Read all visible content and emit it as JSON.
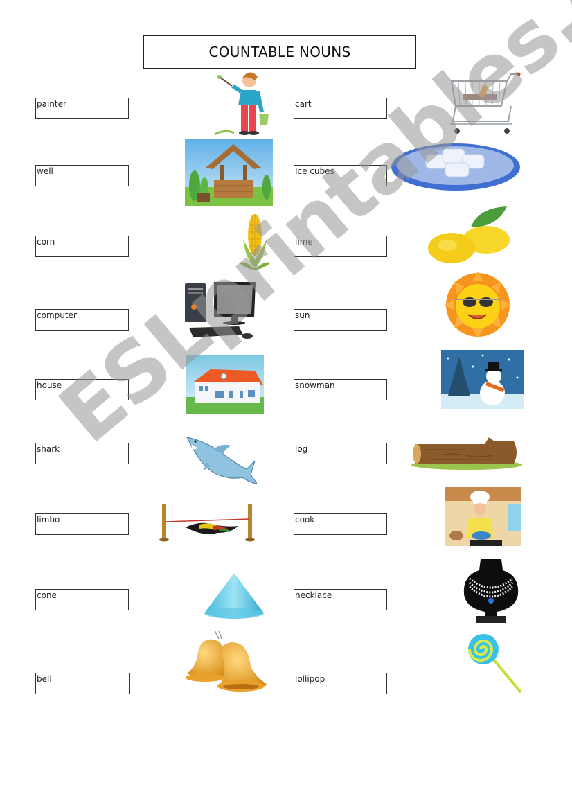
{
  "title": "COUNTABLE NOUNS",
  "watermark": "ESLprintables.com",
  "left_words": [
    "painter",
    "well",
    "corn",
    "computer",
    "house",
    "shark",
    "limbo",
    "cone",
    "bell"
  ],
  "right_words": [
    "cart",
    "Ice cubes",
    "lime",
    "sun",
    "snowman",
    "log",
    "cook",
    "necklace",
    "lollipop"
  ],
  "pictures": {
    "middle": [
      "painter",
      "well",
      "corn",
      "computer",
      "house",
      "shark",
      "limbo",
      "cone",
      "bells"
    ],
    "right": [
      "shopping-cart",
      "ice-cubes-plate",
      "lemons",
      "sun-sunglasses",
      "snowman",
      "log",
      "cook",
      "pearl-necklace",
      "lollipop"
    ]
  }
}
